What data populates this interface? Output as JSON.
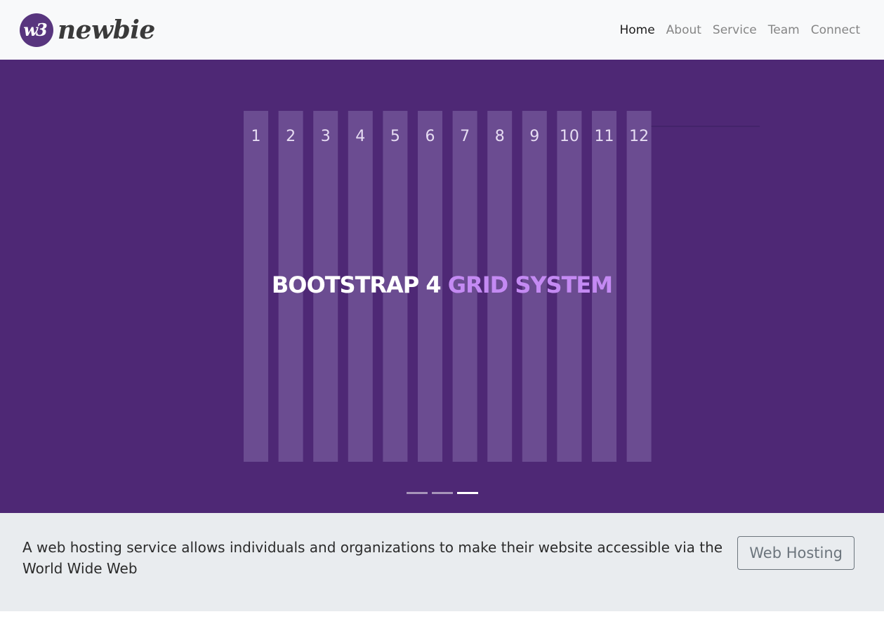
{
  "brand": {
    "badge_text": "w3",
    "wordmark": "newbie",
    "badge_color": "#58357e"
  },
  "nav": {
    "items": [
      {
        "label": "Home",
        "active": true
      },
      {
        "label": "About",
        "active": false
      },
      {
        "label": "Service",
        "active": false
      },
      {
        "label": "Team",
        "active": false
      },
      {
        "label": "Connect",
        "active": false
      }
    ]
  },
  "hero": {
    "background_color": "#4e2875",
    "column_color": "#6b4c91",
    "accent_color": "#c48af3",
    "column_numbers": [
      "1",
      "2",
      "3",
      "4",
      "5",
      "6",
      "7",
      "8",
      "9",
      "10",
      "11",
      "12"
    ],
    "title_main": "BOOTSTRAP 4",
    "title_accent": "GRID SYSTEM",
    "slides": 3,
    "active_slide": 3
  },
  "info": {
    "text": "A web hosting service allows individuals and organizations to make their website accessible via the World Wide Web",
    "button_label": "Web Hosting"
  }
}
